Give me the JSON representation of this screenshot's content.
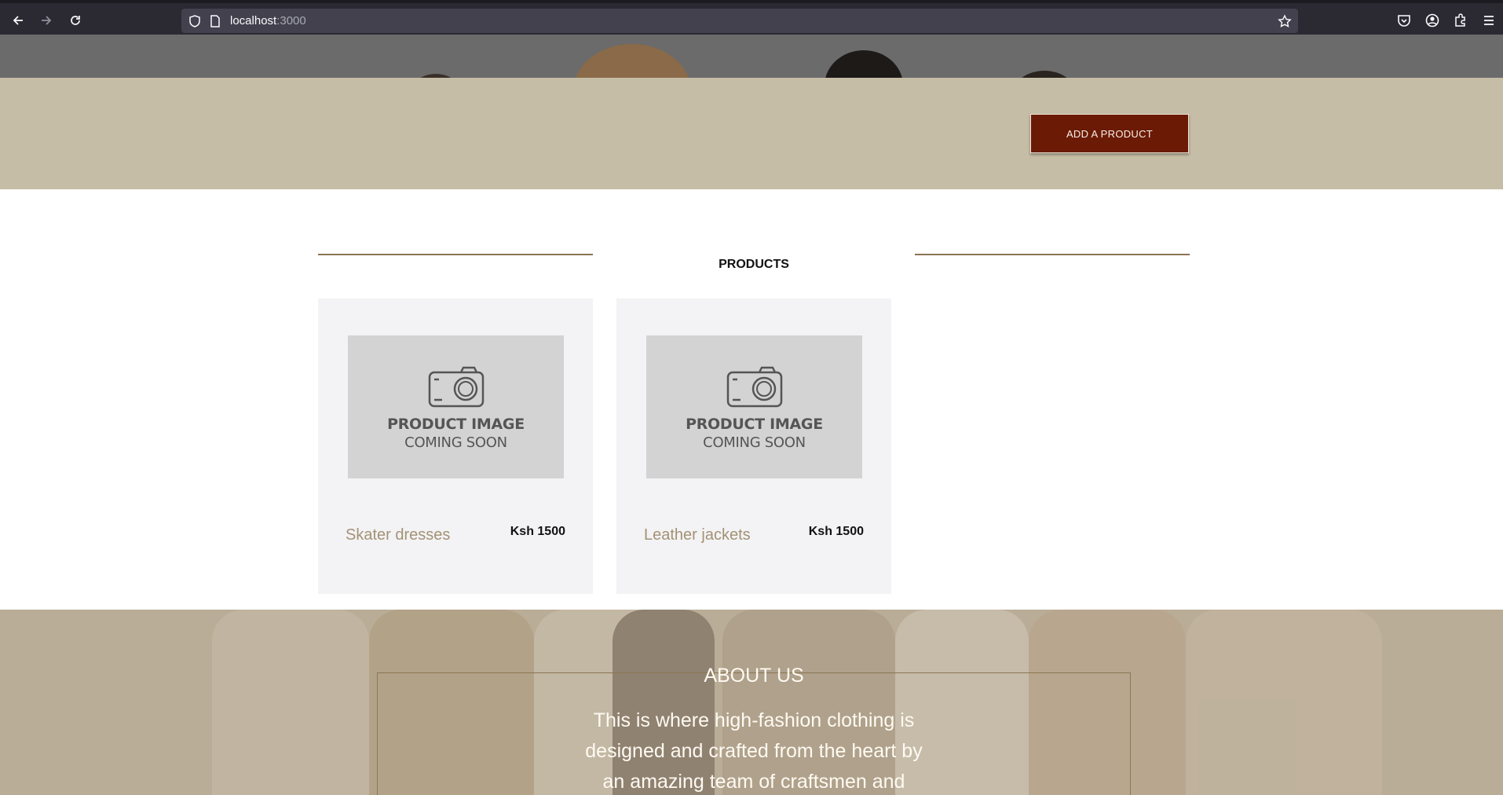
{
  "browser": {
    "url_host": "localhost",
    "url_port": ":3000"
  },
  "banner": {
    "add_product_label": "ADD A PRODUCT"
  },
  "products": {
    "section_title": "PRODUCTS",
    "items": [
      {
        "image_line1": "PRODUCT IMAGE",
        "image_line2": "COMING SOON",
        "name": "Skater dresses",
        "price": "Ksh 1500"
      },
      {
        "image_line1": "PRODUCT IMAGE",
        "image_line2": "COMING SOON",
        "name": "Leather jackets",
        "price": "Ksh 1500"
      }
    ]
  },
  "about": {
    "title": "ABOUT US",
    "text_lines": [
      "This is where high-fashion clothing is",
      "designed and crafted from the heart by",
      "an amazing team of craftsmen and"
    ]
  },
  "colors": {
    "banner_bg": "#c6bda6",
    "button_bg": "#6b1a05",
    "accent_line": "#8a7352",
    "card_bg": "#f3f3f5",
    "product_name": "#a39274"
  }
}
